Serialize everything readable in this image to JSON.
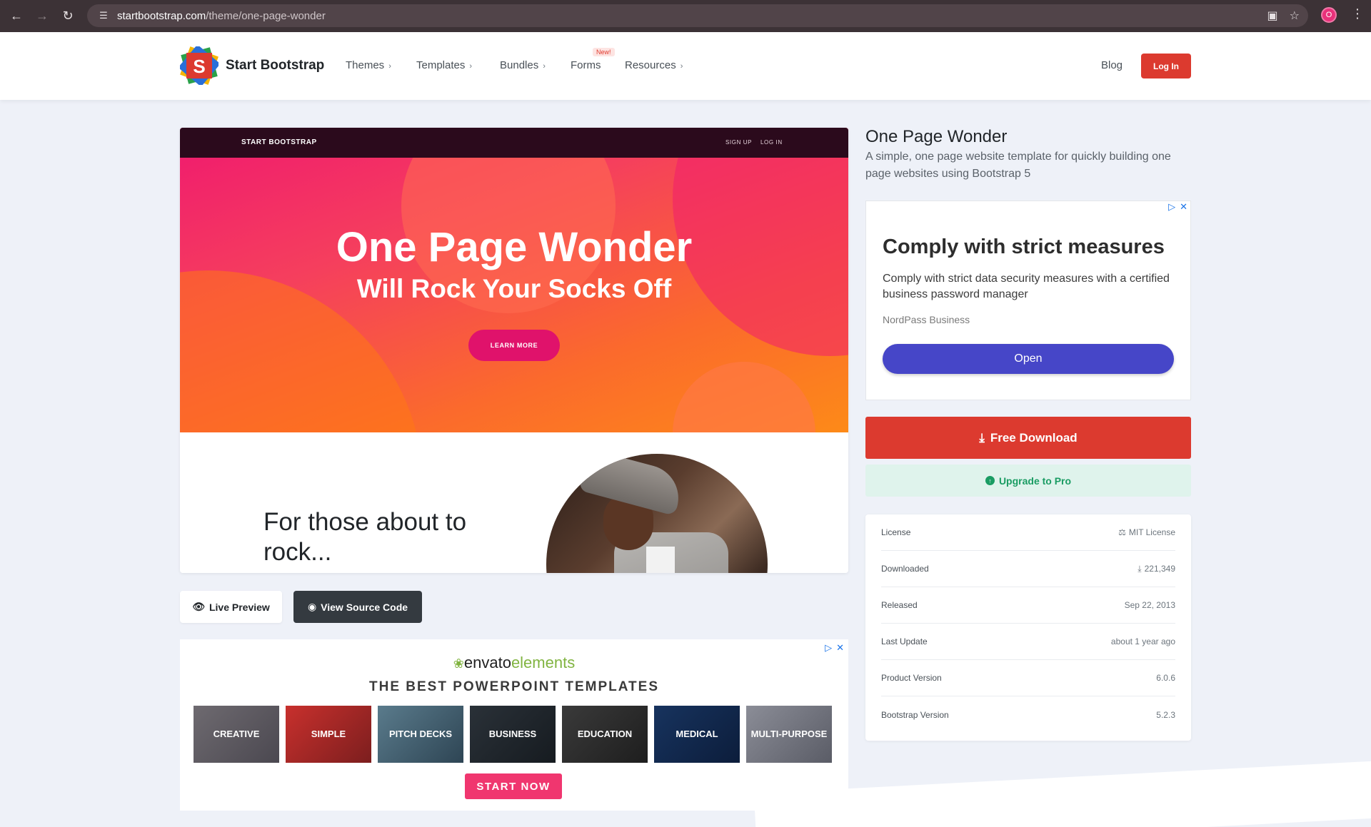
{
  "browser": {
    "url_host": "startbootstrap.com",
    "url_path": "/theme/one-page-wonder",
    "profile_initial": "O"
  },
  "nav": {
    "brand": "Start Bootstrap",
    "items": [
      {
        "label": "Themes"
      },
      {
        "label": "Templates"
      },
      {
        "label": "Bundles"
      },
      {
        "label": "Forms"
      },
      {
        "label": "Resources"
      }
    ],
    "new_badge": "New!",
    "blog": "Blog",
    "login": "Log In"
  },
  "preview": {
    "brand": "START BOOTSTRAP",
    "links": [
      "SIGN UP",
      "LOG IN"
    ],
    "title": "One Page Wonder",
    "subtitle": "Will Rock Your Socks Off",
    "button": "LEARN MORE",
    "section_text": "For those about to rock..."
  },
  "actions": {
    "live_preview": "Live Preview",
    "view_source": "View Source Code"
  },
  "envato_ad": {
    "logo_main": "envato",
    "logo_sub": "elements",
    "headline": "THE BEST POWERPOINT TEMPLATES",
    "categories": [
      "CREATIVE",
      "SIMPLE",
      "PITCH DECKS",
      "BUSINESS",
      "EDUCATION",
      "MEDICAL",
      "MULTI-PURPOSE"
    ],
    "cta": "START NOW"
  },
  "product": {
    "title": "One Page Wonder",
    "description": "A simple, one page website template for quickly building one page websites using Bootstrap 5"
  },
  "side_ad": {
    "title": "Comply with strict measures",
    "body": "Comply with strict data security measures with a certified business password manager",
    "sponsor": "NordPass Business",
    "button": "Open"
  },
  "download": {
    "free_label": "Free Download",
    "upgrade_label": "Upgrade to Pro"
  },
  "info": [
    {
      "label": "License",
      "value": "MIT License"
    },
    {
      "label": "Downloaded",
      "value": "221,349"
    },
    {
      "label": "Released",
      "value": "Sep 22, 2013"
    },
    {
      "label": "Last Update",
      "value": "about 1 year ago"
    },
    {
      "label": "Product Version",
      "value": "6.0.6"
    },
    {
      "label": "Bootstrap Version",
      "value": "5.2.3"
    }
  ],
  "colors": {
    "brand_red": "#dc3a2f",
    "ad_button": "#4646c8",
    "upgrade_green": "#1a9c63",
    "envato_cta": "#f0366f"
  }
}
